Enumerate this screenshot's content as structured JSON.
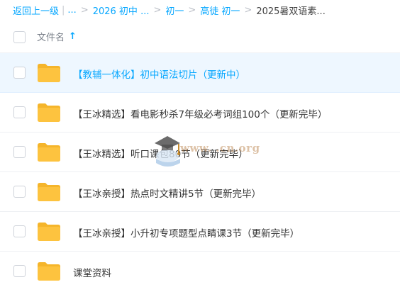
{
  "breadcrumb": {
    "back_label": "返回上一级",
    "ellipsis": "...",
    "items": [
      "2026 初中 ...",
      "初一",
      "高徒 初一"
    ],
    "current": "2025暑双语素..."
  },
  "table": {
    "header_name": "文件名",
    "sort_icon": "arrow-up-icon"
  },
  "rows": [
    {
      "name": "【教辅一体化】初中语法切片（更新中）",
      "active": true
    },
    {
      "name": "【王冰精选】看电影秒杀7年级必考词组100个（更新完毕）",
      "active": false
    },
    {
      "name": "【王冰精选】听口课包80节（更新完毕）",
      "active": false
    },
    {
      "name": "【王冰亲授】热点时文精讲5节（更新完毕）",
      "active": false
    },
    {
      "name": "【王冰亲授】小升初专项题型点睛课3节（更新完毕）",
      "active": false
    },
    {
      "name": "课堂资料",
      "active": false
    }
  ],
  "watermark": {
    "text": "www.  .cn.org"
  },
  "colors": {
    "accent": "#06a7ff",
    "folder": "#fdc33f",
    "active_row": "#eef7ff"
  }
}
